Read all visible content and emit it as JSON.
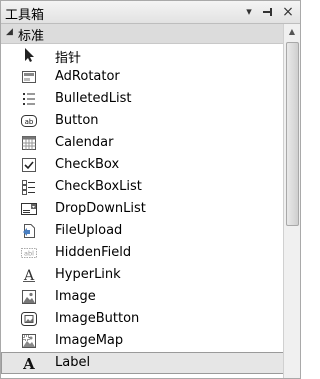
{
  "window": {
    "title": "工具箱"
  },
  "titlebar": {
    "menu_glyph": "▾",
    "pin_glyph": "ᅳ",
    "close_glyph": "×"
  },
  "group": {
    "label": "标准",
    "expanded_glyph": "◢"
  },
  "items": [
    {
      "label": "指针",
      "icon": "pointer-icon"
    },
    {
      "label": "AdRotator",
      "icon": "adrotator-icon"
    },
    {
      "label": "BulletedList",
      "icon": "bulleted-list-icon"
    },
    {
      "label": "Button",
      "icon": "button-icon"
    },
    {
      "label": "Calendar",
      "icon": "calendar-icon"
    },
    {
      "label": "CheckBox",
      "icon": "checkbox-icon"
    },
    {
      "label": "CheckBoxList",
      "icon": "checkbox-list-icon"
    },
    {
      "label": "DropDownList",
      "icon": "dropdown-list-icon"
    },
    {
      "label": "FileUpload",
      "icon": "file-upload-icon"
    },
    {
      "label": "HiddenField",
      "icon": "hidden-field-icon"
    },
    {
      "label": "HyperLink",
      "icon": "hyperlink-icon"
    },
    {
      "label": "Image",
      "icon": "image-icon"
    },
    {
      "label": "ImageButton",
      "icon": "image-button-icon"
    },
    {
      "label": "ImageMap",
      "icon": "image-map-icon"
    },
    {
      "label": "Label",
      "icon": "label-icon",
      "selected": true
    }
  ],
  "icon_text": {
    "button": "ab",
    "hidden": "abl",
    "letter": "A"
  }
}
